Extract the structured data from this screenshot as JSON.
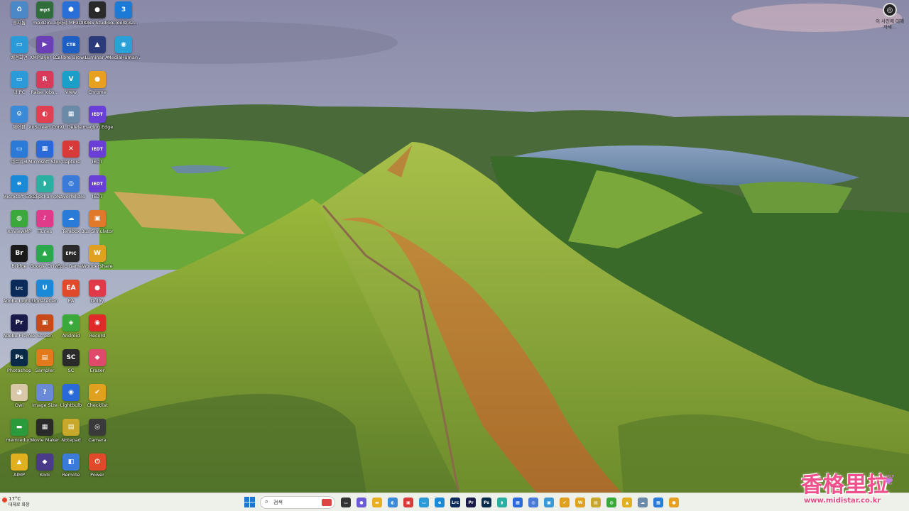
{
  "desktop_icons": [
    {
      "label": "휴지통",
      "abbr": "♻",
      "color": "#4a88c8"
    },
    {
      "label": "mp3Dire...",
      "abbr": "mp3",
      "color": "#2f6d3a"
    },
    {
      "label": "테라리 MP3DIREC...",
      "abbr": "⬢",
      "color": "#2a6fd8"
    },
    {
      "label": "OBS Studio",
      "abbr": "●",
      "color": "#2a2a2a"
    },
    {
      "label": "3uTools(32...",
      "abbr": "3",
      "color": "#1a7ad6"
    },
    {
      "label": "배경화면",
      "abbr": "▭",
      "color": "#2b9ad8"
    },
    {
      "label": "XMPlayer 6.x",
      "abbr": "▶",
      "color": "#6a3fb8"
    },
    {
      "label": "Calibre Browse",
      "abbr": "CTB",
      "color": "#1e5fc4"
    },
    {
      "label": "Luminar AI",
      "abbr": "▲",
      "color": "#2a3a7a"
    },
    {
      "label": "MediaHuman Audio Con...",
      "abbr": "◉",
      "color": "#2aa0d8"
    },
    {
      "label": "내 PC",
      "abbr": "▭",
      "color": "#2b9ad8"
    },
    {
      "label": "Raise Jobs...",
      "abbr": "R",
      "color": "#d83a5a"
    },
    {
      "label": "Vrew",
      "abbr": "V",
      "color": "#1aa0c8"
    },
    {
      "label": "Chrome",
      "abbr": "●",
      "color": "#e8a020"
    },
    {
      "label": "제어판",
      "abbr": "⚙",
      "color": "#3a8ad8"
    },
    {
      "label": "XnScreen Contro",
      "abbr": "◐",
      "color": "#e04050"
    },
    {
      "label": "XL Delete",
      "abbr": "▦",
      "color": "#6a8aa8"
    },
    {
      "label": "Imaging Edge",
      "abbr": "IEDT",
      "color": "#6a3fd8"
    },
    {
      "label": "네트워크",
      "abbr": "▭",
      "color": "#2b7ad8"
    },
    {
      "label": "Microsoft Store",
      "abbr": "▦",
      "color": "#2a6ad8"
    },
    {
      "label": "Capture",
      "abbr": "✕",
      "color": "#d83a3a"
    },
    {
      "label": "IEDT",
      "abbr": "IEDT",
      "color": "#6a3fd8"
    },
    {
      "label": "Microsoft Edge",
      "abbr": "e",
      "color": "#1a8ad8"
    },
    {
      "label": "Clipchamp",
      "abbr": "◗",
      "color": "#2ab0a0"
    },
    {
      "label": "NaverWhale",
      "abbr": "◎",
      "color": "#3a7ad8"
    },
    {
      "label": "IEDT",
      "abbr": "IEDT",
      "color": "#6a3fd8"
    },
    {
      "label": "XnViewMP",
      "abbr": "◍",
      "color": "#3aa83a"
    },
    {
      "label": "iTunes",
      "abbr": "♪",
      "color": "#e03a8a"
    },
    {
      "label": "Terabox",
      "abbr": "☁",
      "color": "#2a7ad8"
    },
    {
      "label": "Bus Simulator",
      "abbr": "▣",
      "color": "#e07a2a"
    },
    {
      "label": "Bridge",
      "abbr": "Br",
      "color": "#1a1a1a"
    },
    {
      "label": "Google Drive",
      "abbr": "▲",
      "color": "#2aa84a"
    },
    {
      "label": "Epic Games",
      "abbr": "EPIC",
      "color": "#2a2a2a"
    },
    {
      "label": "Wondershare",
      "abbr": "W",
      "color": "#e0a020"
    },
    {
      "label": "Adobe Lightroo",
      "abbr": "Lrc",
      "color": "#0a2a5a"
    },
    {
      "label": "UpdateCen",
      "abbr": "U",
      "color": "#1a8ad8"
    },
    {
      "label": "EA",
      "abbr": "EA",
      "color": "#e04a2a"
    },
    {
      "label": "Dolby",
      "abbr": "●",
      "color": "#e03a4a"
    },
    {
      "label": "Adobe Premiere",
      "abbr": "Pr",
      "color": "#1a1a4a"
    },
    {
      "label": "Screen",
      "abbr": "▣",
      "color": "#c84a1a"
    },
    {
      "label": "Android",
      "abbr": "◈",
      "color": "#3aa83a"
    },
    {
      "label": "Record",
      "abbr": "◉",
      "color": "#e02a2a"
    },
    {
      "label": "Photoshop",
      "abbr": "Ps",
      "color": "#0a2a4a"
    },
    {
      "label": "Sampler",
      "abbr": "▤",
      "color": "#e07a1a"
    },
    {
      "label": "SC",
      "abbr": "SC",
      "color": "#2a2a2a"
    },
    {
      "label": "Eraser",
      "abbr": "◆",
      "color": "#e04a6a"
    },
    {
      "label": "Owl",
      "abbr": "◕",
      "color": "#d8c8a8"
    },
    {
      "label": "Image Size",
      "abbr": "?",
      "color": "#6a8ad8"
    },
    {
      "label": "Lightbulb",
      "abbr": "◉",
      "color": "#2a6ad8"
    },
    {
      "label": "Checklist",
      "abbr": "✔",
      "color": "#e0a020"
    },
    {
      "label": "memreduct",
      "abbr": "▬",
      "color": "#2a9a3a"
    },
    {
      "label": "Movie Maker",
      "abbr": "▦",
      "color": "#2a2a2a"
    },
    {
      "label": "Notepad",
      "abbr": "▤",
      "color": "#c8a82a"
    },
    {
      "label": "Camera",
      "abbr": "◎",
      "color": "#3a3a3a"
    },
    {
      "label": "AIMP",
      "abbr": "▲",
      "color": "#e0b020"
    },
    {
      "label": "Kodi",
      "abbr": "◆",
      "color": "#4a3a8a"
    },
    {
      "label": "Remote",
      "abbr": "◧",
      "color": "#3a7ad8"
    },
    {
      "label": "Power",
      "abbr": "⏻",
      "color": "#e04a2a"
    }
  ],
  "top_right_widget": {
    "label": "이 사진에 대해 자세...",
    "icon": "camera-icon"
  },
  "taskbar": {
    "weather": {
      "temp": "17°C",
      "desc": "대체로 화창"
    },
    "search_placeholder": "검색",
    "icons": [
      {
        "name": "task-view",
        "abbr": "▭",
        "color": "#333"
      },
      {
        "name": "chat",
        "abbr": "●",
        "color": "#6a5ad8"
      },
      {
        "name": "file-explorer",
        "abbr": "▬",
        "color": "#e8b020"
      },
      {
        "name": "copilot",
        "abbr": "◐",
        "color": "#3a8ad8"
      },
      {
        "name": "pdf",
        "abbr": "▣",
        "color": "#d83a3a"
      },
      {
        "name": "desktop",
        "abbr": "▭",
        "color": "#2b9ad8"
      },
      {
        "name": "edge",
        "abbr": "e",
        "color": "#1a8ad8"
      },
      {
        "name": "lightroom",
        "abbr": "Lrc",
        "color": "#0a2a5a"
      },
      {
        "name": "premiere",
        "abbr": "Pr",
        "color": "#1a1a4a"
      },
      {
        "name": "photoshop",
        "abbr": "Ps",
        "color": "#0a2a4a"
      },
      {
        "name": "clipchamp",
        "abbr": "◗",
        "color": "#2ab0a0"
      },
      {
        "name": "store",
        "abbr": "▦",
        "color": "#2a6ad8"
      },
      {
        "name": "camera",
        "abbr": "◎",
        "color": "#4a7ad8"
      },
      {
        "name": "photos",
        "abbr": "▣",
        "color": "#3a9ad8"
      },
      {
        "name": "checklist",
        "abbr": "✔",
        "color": "#e0a020"
      },
      {
        "name": "wondershare",
        "abbr": "W",
        "color": "#e0a020"
      },
      {
        "name": "sticky",
        "abbr": "▤",
        "color": "#c8a82a"
      },
      {
        "name": "xnview",
        "abbr": "◍",
        "color": "#3aa83a"
      },
      {
        "name": "aimp",
        "abbr": "▲",
        "color": "#e0b020"
      },
      {
        "name": "cloud",
        "abbr": "☁",
        "color": "#6a8aa8"
      },
      {
        "name": "calculator",
        "abbr": "▦",
        "color": "#2a7ad8"
      },
      {
        "name": "chrome",
        "abbr": "●",
        "color": "#e8a020"
      }
    ]
  },
  "watermark": {
    "title": "香格里拉",
    "url": "www.midistar.co.kr"
  }
}
